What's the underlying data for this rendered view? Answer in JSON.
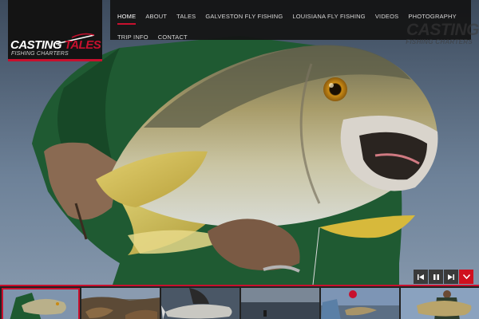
{
  "logo": {
    "word1": "CASTING",
    "word2": "TALES",
    "subline": "FISHING CHARTERS"
  },
  "nav": {
    "items": [
      {
        "label": "HOME",
        "active": true
      },
      {
        "label": "ABOUT"
      },
      {
        "label": "TALES"
      },
      {
        "label": "GALVESTON FLY FISHING"
      },
      {
        "label": "LOUISIANA FLY FISHING"
      },
      {
        "label": "VIDEOS"
      },
      {
        "label": "PHOTOGRAPHY"
      },
      {
        "label": "TRIP INFO"
      },
      {
        "label": "CONTACT"
      }
    ]
  },
  "watermark": {
    "main": "CASTING",
    "sub": "FISHING CHARTERS"
  },
  "controls": {
    "icons": [
      "previous-icon",
      "pause-icon",
      "next-icon",
      "chevron-down-icon"
    ]
  },
  "thumbnails": [
    {
      "icon": "redfish-photo",
      "active": true
    },
    {
      "icon": "rocks-photo"
    },
    {
      "icon": "fish-closeup-photo"
    },
    {
      "icon": "water-photo"
    },
    {
      "icon": "angler-photo"
    },
    {
      "icon": "fish-held-photo"
    }
  ],
  "colors": {
    "accent": "#c8102e",
    "nav_bg": "#141414",
    "control_bg": "#3a3a3a"
  }
}
